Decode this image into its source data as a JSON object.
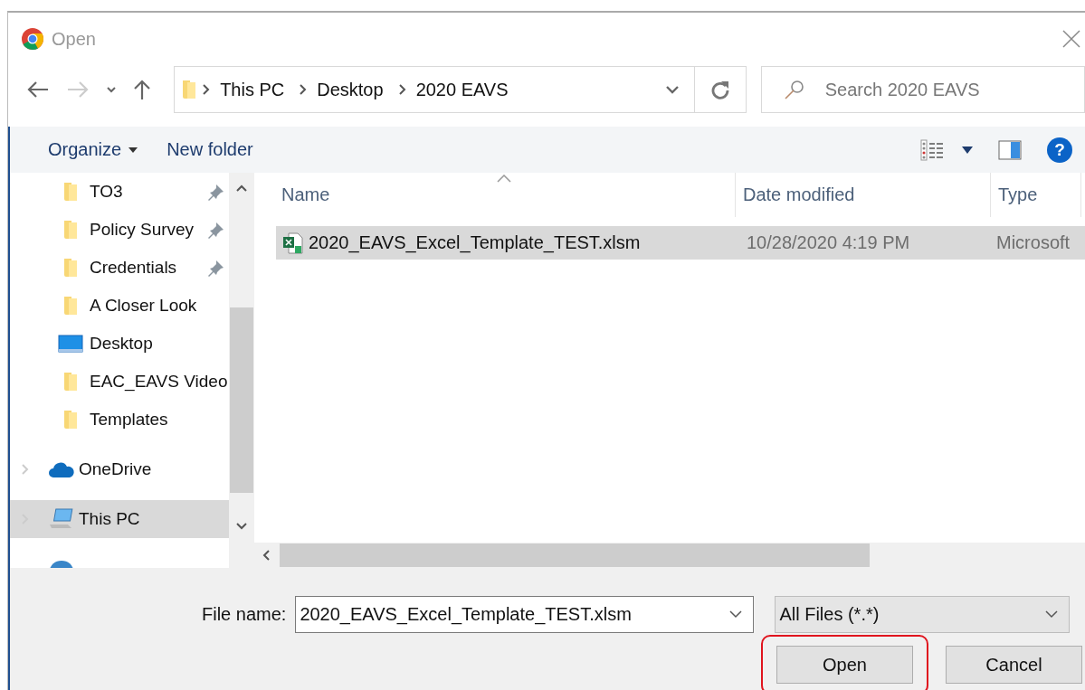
{
  "window": {
    "title": "Open"
  },
  "address_bar": {
    "breadcrumbs": [
      "This PC",
      "Desktop",
      "2020 EAVS"
    ]
  },
  "search": {
    "placeholder": "Search 2020 EAVS"
  },
  "toolbar": {
    "organize": "Organize",
    "new_folder": "New folder",
    "help": "?"
  },
  "navigation": [
    {
      "label": "TO3",
      "kind": "folder",
      "pinned": true,
      "selected": false
    },
    {
      "label": "Policy Survey",
      "kind": "folder",
      "pinned": true,
      "selected": false
    },
    {
      "label": "Credentials",
      "kind": "folder",
      "pinned": true,
      "selected": false
    },
    {
      "label": "A Closer Look",
      "kind": "folder",
      "pinned": false,
      "selected": false
    },
    {
      "label": "Desktop",
      "kind": "desktop",
      "pinned": false,
      "selected": false
    },
    {
      "label": "EAC_EAVS Video",
      "kind": "folder",
      "pinned": false,
      "selected": false
    },
    {
      "label": "Templates",
      "kind": "folder",
      "pinned": false,
      "selected": false
    },
    {
      "label": "OneDrive",
      "kind": "cloud",
      "pinned": false,
      "selected": false
    },
    {
      "label": "This PC",
      "kind": "pc",
      "pinned": false,
      "selected": true
    }
  ],
  "columns": [
    "Name",
    "Date modified",
    "Type"
  ],
  "files": [
    {
      "name": "2020_EAVS_Excel_Template_TEST.xlsm",
      "date": "10/28/2020 4:19 PM",
      "type": "Microsoft",
      "selected": true
    }
  ],
  "file_name": {
    "label": "File name:",
    "value": "2020_EAVS_Excel_Template_TEST.xlsm"
  },
  "file_type": {
    "value": "All Files (*.*)"
  },
  "buttons": [
    {
      "label": "Open",
      "highlighted": true
    },
    {
      "label": "Cancel",
      "highlighted": false
    }
  ]
}
